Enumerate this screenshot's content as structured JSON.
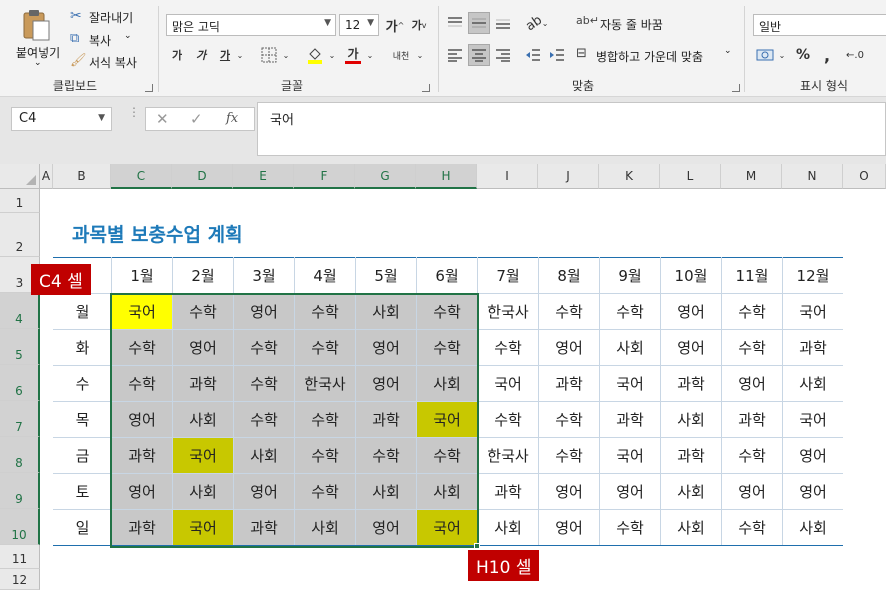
{
  "ribbon": {
    "clipboard": {
      "paste_label": "붙여넣기",
      "cut_label": "잘라내기",
      "copy_label": "복사",
      "format_painter_label": "서식 복사",
      "group_label": "클립보드"
    },
    "font": {
      "font_name": "맑은 고딕",
      "font_size": "12",
      "bold_label": "가",
      "italic_label": "가",
      "underline_label": "가",
      "increase_label": "가",
      "decrease_label": "가",
      "font_color_label": "가",
      "phonetic_label": "내천",
      "group_label": "글꼴"
    },
    "alignment": {
      "wrap_label": "자동 줄 바꿈",
      "merge_label": "병합하고 가운데 맞춤",
      "group_label": "맞춤"
    },
    "number": {
      "format_value": "일반",
      "percent_label": "%",
      "comma_label": ",",
      "group_label": "표시 형식"
    }
  },
  "formula_bar": {
    "name_box": "C4",
    "fx_label": "fx",
    "formula": "국어"
  },
  "sheet": {
    "columns": [
      "A",
      "B",
      "C",
      "D",
      "E",
      "F",
      "G",
      "H",
      "I",
      "J",
      "K",
      "L",
      "M",
      "N",
      "O"
    ],
    "rows": [
      "1",
      "2",
      "3",
      "4",
      "5",
      "6",
      "7",
      "8",
      "9",
      "10",
      "11",
      "12"
    ],
    "title": "과목별 보충수업 계획",
    "months": [
      "1월",
      "2월",
      "3월",
      "4월",
      "5월",
      "6월",
      "7월",
      "8월",
      "9월",
      "10월",
      "11월",
      "12월"
    ],
    "days": [
      "월",
      "화",
      "수",
      "목",
      "금",
      "토",
      "일"
    ],
    "table": [
      [
        "국어",
        "수학",
        "영어",
        "수학",
        "사회",
        "수학",
        "한국사",
        "수학",
        "수학",
        "영어",
        "수학",
        "국어"
      ],
      [
        "수학",
        "영어",
        "수학",
        "수학",
        "영어",
        "수학",
        "수학",
        "영어",
        "사회",
        "영어",
        "수학",
        "과학"
      ],
      [
        "수학",
        "과학",
        "수학",
        "한국사",
        "영어",
        "사회",
        "국어",
        "과학",
        "국어",
        "과학",
        "영어",
        "사회"
      ],
      [
        "영어",
        "사회",
        "수학",
        "수학",
        "과학",
        "국어",
        "수학",
        "수학",
        "과학",
        "사회",
        "과학",
        "국어"
      ],
      [
        "과학",
        "국어",
        "사회",
        "수학",
        "수학",
        "수학",
        "한국사",
        "수학",
        "국어",
        "과학",
        "수학",
        "영어"
      ],
      [
        "영어",
        "사회",
        "영어",
        "수학",
        "사회",
        "사회",
        "과학",
        "영어",
        "영어",
        "사회",
        "영어",
        "영어"
      ],
      [
        "과학",
        "국어",
        "과학",
        "사회",
        "영어",
        "국어",
        "사회",
        "영어",
        "수학",
        "사회",
        "수학",
        "사회"
      ]
    ],
    "colors": {
      "selection_fill": "#c8c8c8",
      "active_cell": "#ffff00",
      "highlight": "#c8c800",
      "title": "#1e7ab9",
      "tag": "#c00000"
    }
  },
  "annotations": {
    "start_tag": "C4 셀",
    "end_tag": "H10 셀"
  }
}
